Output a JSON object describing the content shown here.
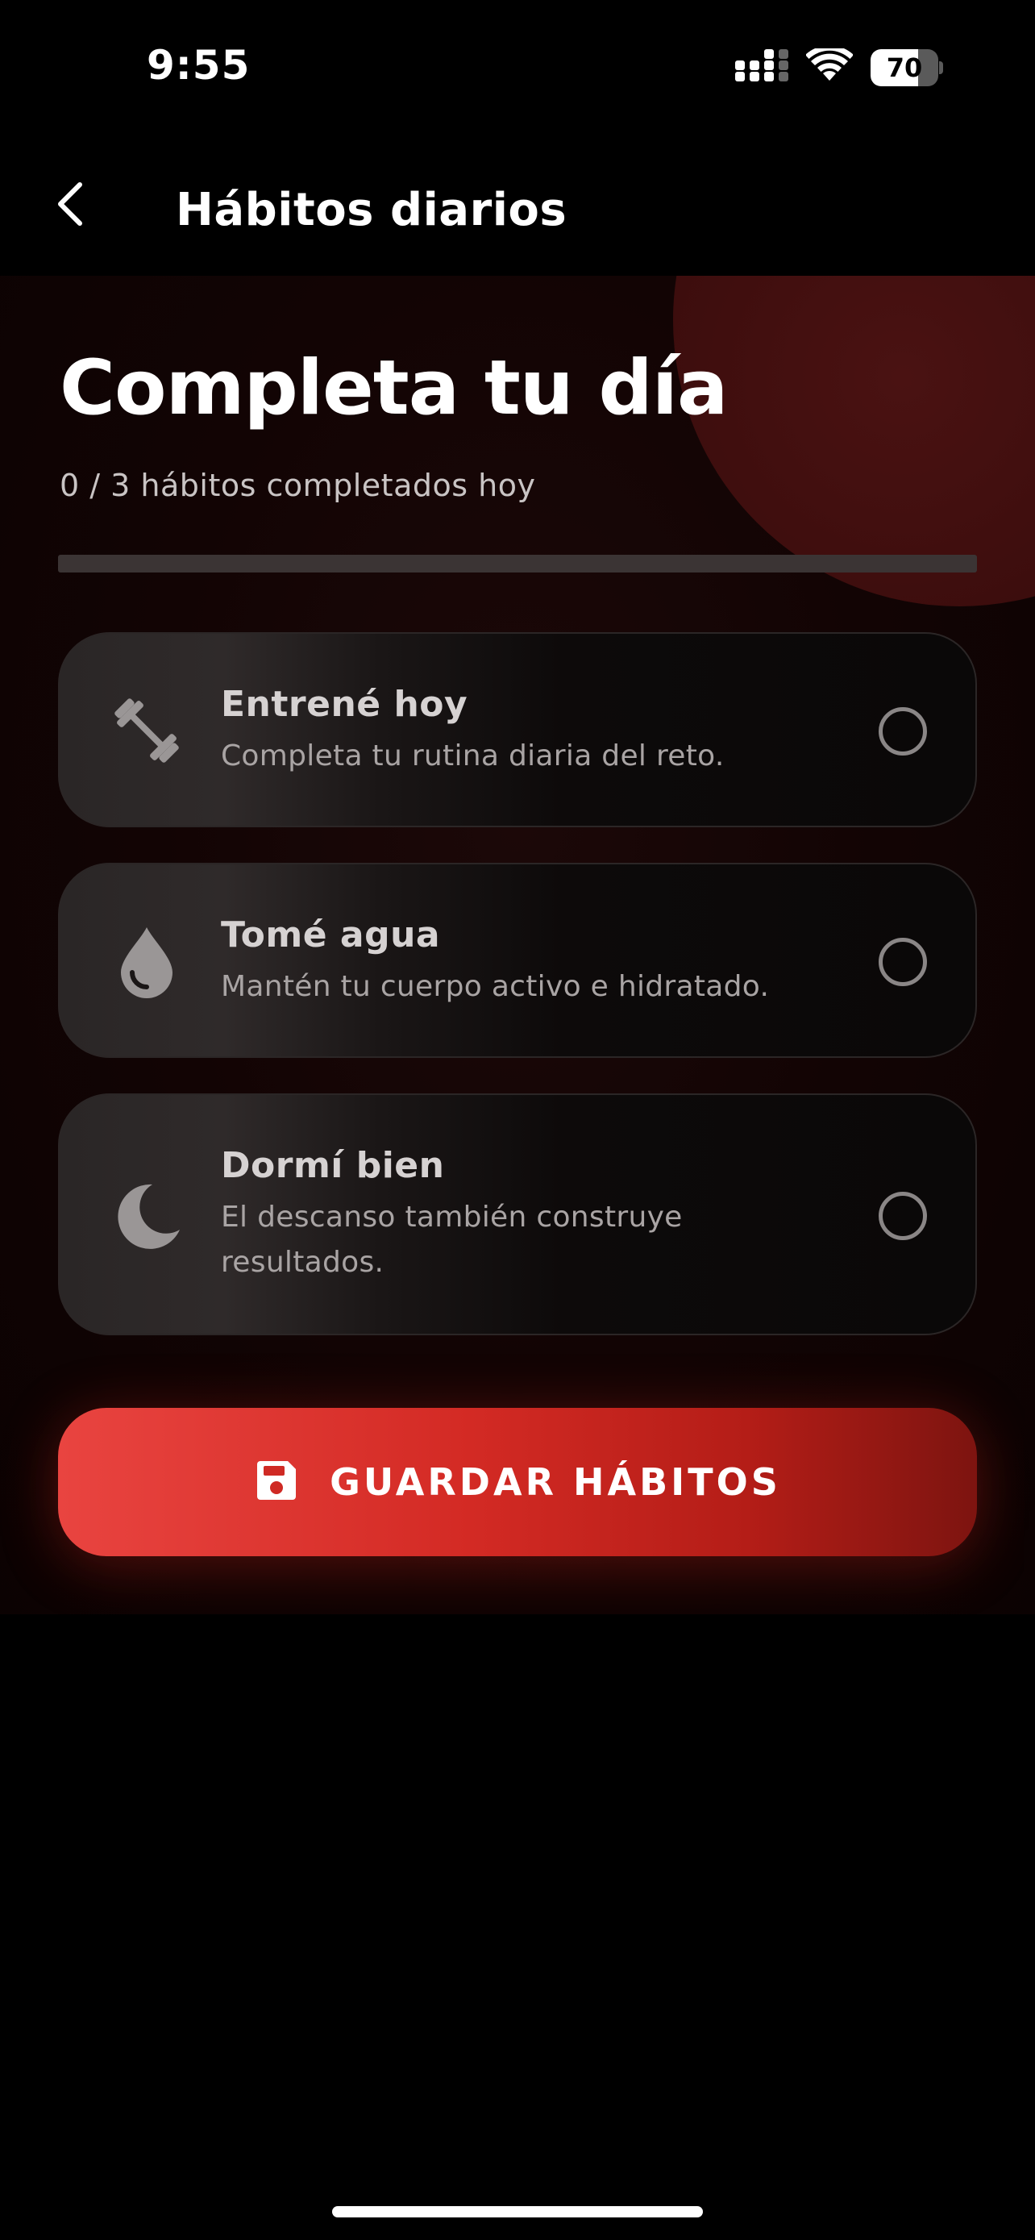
{
  "status_bar": {
    "time": "9:55",
    "battery_level": "70",
    "battery_fraction": 0.7,
    "icons": [
      "cellular-signal-icon",
      "wifi-icon",
      "battery-icon"
    ]
  },
  "header": {
    "title": "Hábitos diarios",
    "back_icon": "chevron-left-icon"
  },
  "main": {
    "title": "Completa tu día",
    "progress_text": "0 / 3 hábitos completados hoy",
    "progress_fraction": 0,
    "habits": [
      {
        "title": "Entrené hoy",
        "description": "Completa tu rutina diaria del reto.",
        "icon": "dumbbell-icon",
        "checked": false
      },
      {
        "title": "Tomé agua",
        "description": "Mantén tu cuerpo activo e hidratado.",
        "icon": "water-drop-icon",
        "checked": false
      },
      {
        "title": "Dormí bien",
        "description": "El descanso también construye resultados.",
        "icon": "moon-icon",
        "checked": false
      }
    ],
    "save_button": {
      "label": "GUARDAR HÁBITOS",
      "icon": "floppy-disk-icon"
    }
  },
  "colors": {
    "accent": "#e53935",
    "background": "#000000",
    "card_border": "#2b2626"
  }
}
